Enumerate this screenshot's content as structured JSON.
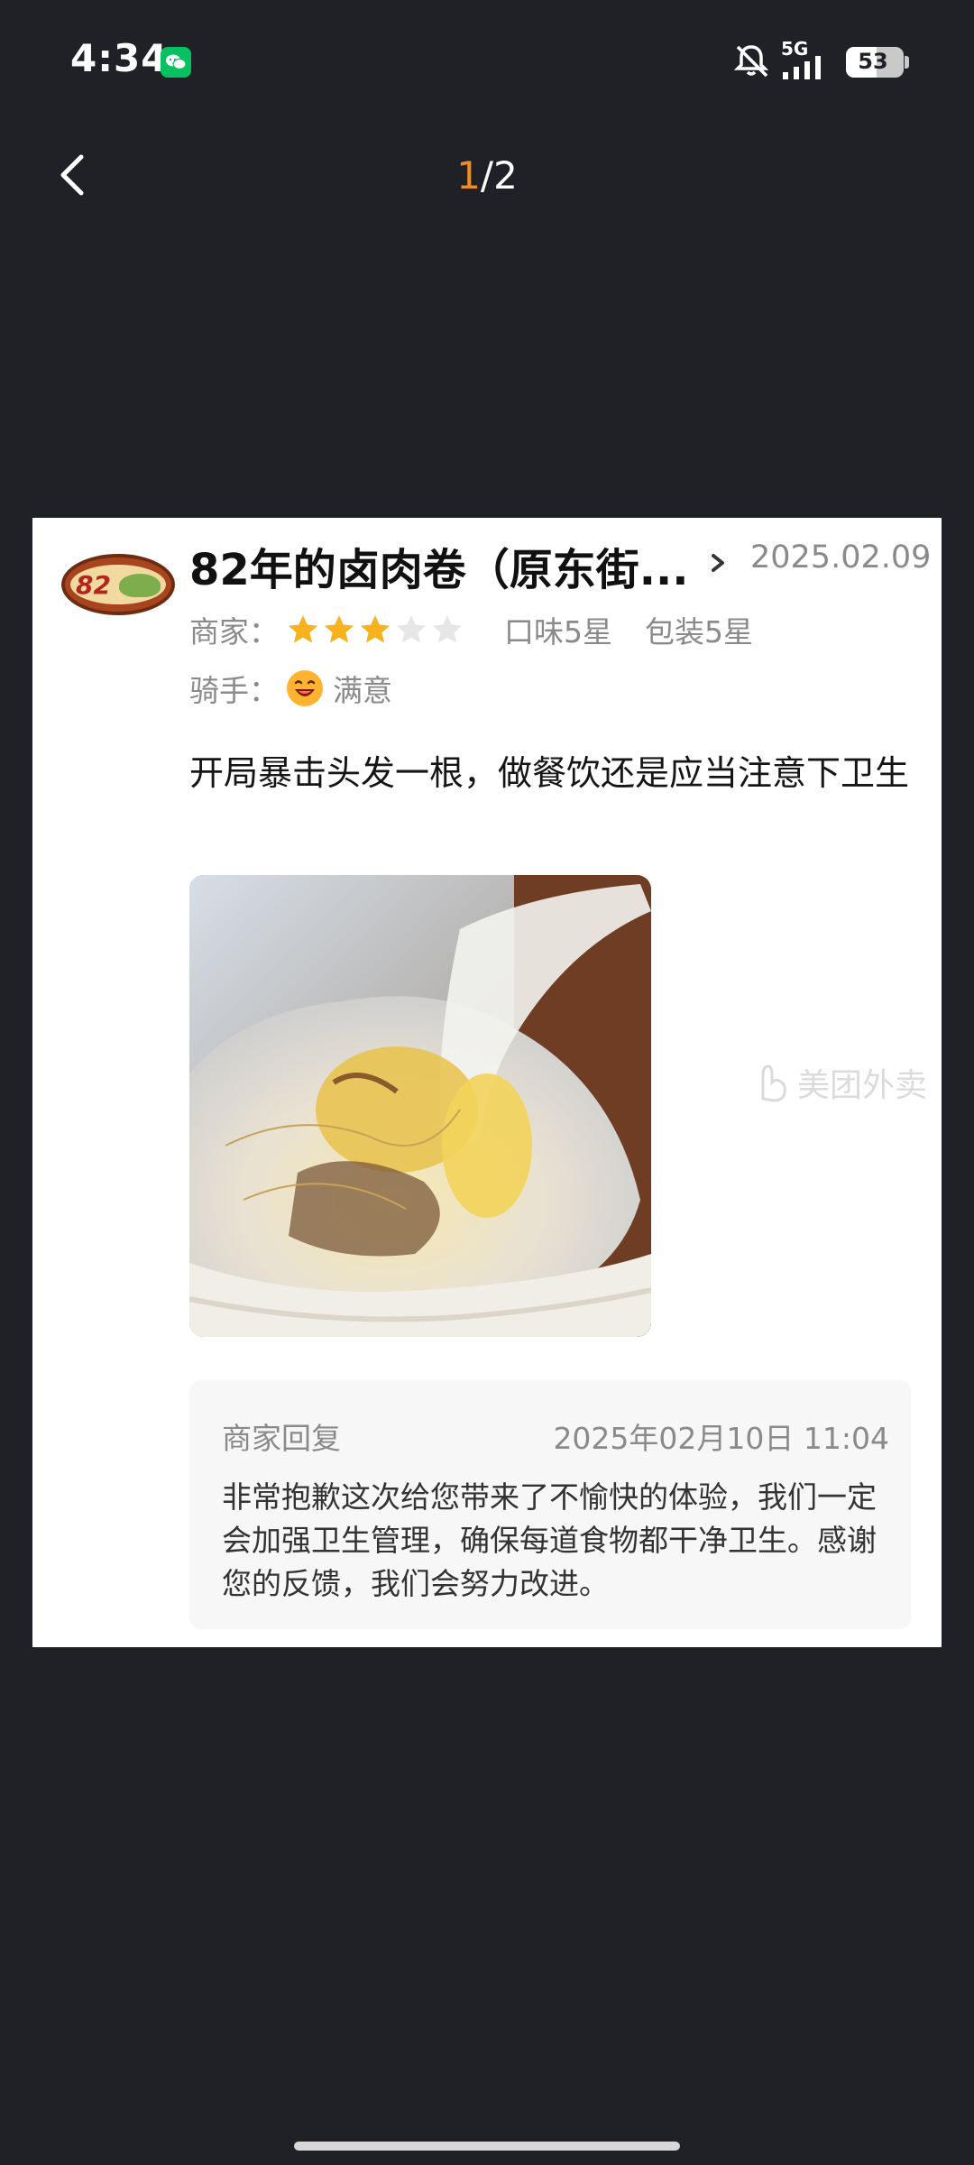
{
  "status_bar": {
    "time": "4:34",
    "network": "5G",
    "battery": "53",
    "battery_level_percent": 53,
    "icons": [
      "wechat-icon",
      "mute-icon",
      "signal-icon",
      "battery-icon"
    ]
  },
  "nav": {
    "page_current": "1",
    "page_total": "/2",
    "back_icon": "chevron-left-icon"
  },
  "review": {
    "shop_name": "82年的卤肉卷（原东街...",
    "date": "2025.02.09",
    "merchant_label": "商家：",
    "merchant_rating": 3,
    "merchant_rating_max": 5,
    "taste": "口味5星",
    "packaging": "包装5星",
    "rider_label": "骑手：",
    "rider_rating": "满意",
    "text": "开局暴击头发一根，做餐饮还是应当注意下卫生",
    "colors": {
      "star_filled": "#f7b21f",
      "star_empty": "#e6e6e6",
      "accent": "#f08c26"
    }
  },
  "reply": {
    "label": "商家回复",
    "time": "2025年02月10日 11:04",
    "text": "非常抱歉这次给您带来了不愉快的体验，我们一定会加强卫生管理，确保每道食物都干净卫生。感谢您的反馈，我们会努力改进。"
  },
  "watermark": "美团外卖"
}
